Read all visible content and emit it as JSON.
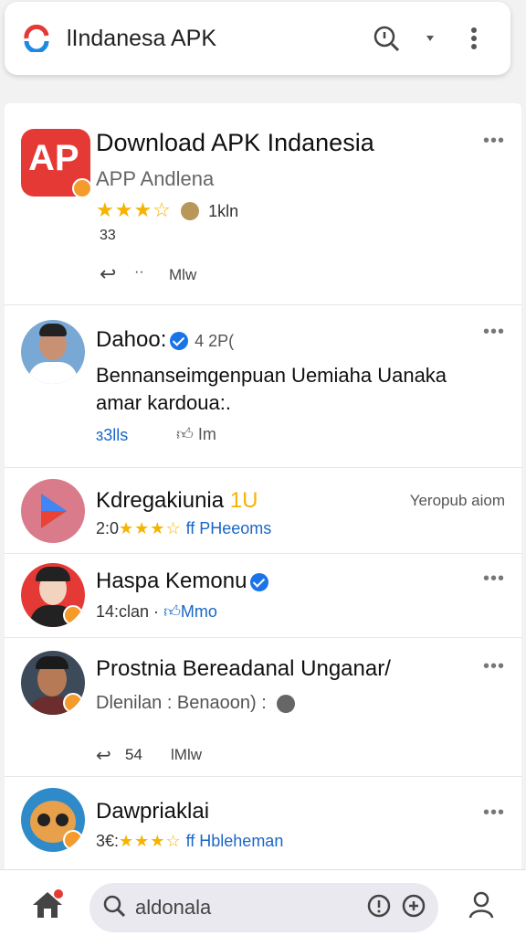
{
  "header": {
    "title": "lIndanesa APK",
    "icons": [
      "logo-icon",
      "search-icon",
      "dropdown-icon",
      "more-vertical-icon"
    ]
  },
  "feed": {
    "posts": [
      {
        "title": "Download APK Indanesia",
        "subtitle": "APP Andlena",
        "rating": "★★★☆",
        "count": "1kln",
        "extra": "33",
        "action_label": "Mlw",
        "more": "•••"
      },
      {
        "name": "Dahoo:",
        "time": "4 2P(",
        "body": [
          "Bennanseimgenpuan Uemiaha Uanaka",
          "amar kardoua:."
        ],
        "stat1": "3lls",
        "stat2": "Im",
        "more": "•••"
      },
      {
        "name": "Kdregakiunia",
        "name_suffix": "1U",
        "meta_prefix": "2:0",
        "stars": "★★★☆",
        "meta_link": "ff PHeeoms",
        "right_text": "Yeropub aiom",
        "more": ""
      },
      {
        "name": "Haspa Kemonu",
        "meta": "14:clan ·",
        "meta_link": "Mmo",
        "more": "•••"
      },
      {
        "title": "Prostnia Bereadanal Unganar/",
        "subtitle": "Dlenilan : Benaoon) :",
        "count": "54",
        "action_label": "lMlw",
        "more": "•••"
      },
      {
        "name": "Dawpriaklai",
        "meta_prefix": "3€:",
        "stars": "★★★☆",
        "meta_link": "ff Hbleheman",
        "more": "•••"
      }
    ]
  },
  "bottom": {
    "search_placeholder": "aldonala",
    "icons": [
      "home-icon",
      "search-icon",
      "info-icon",
      "add-icon",
      "profile-icon"
    ]
  },
  "colors": {
    "brand": "#e53935",
    "accent": "#1a73e8",
    "star": "#f4b400",
    "badge": "#f49b2c"
  }
}
